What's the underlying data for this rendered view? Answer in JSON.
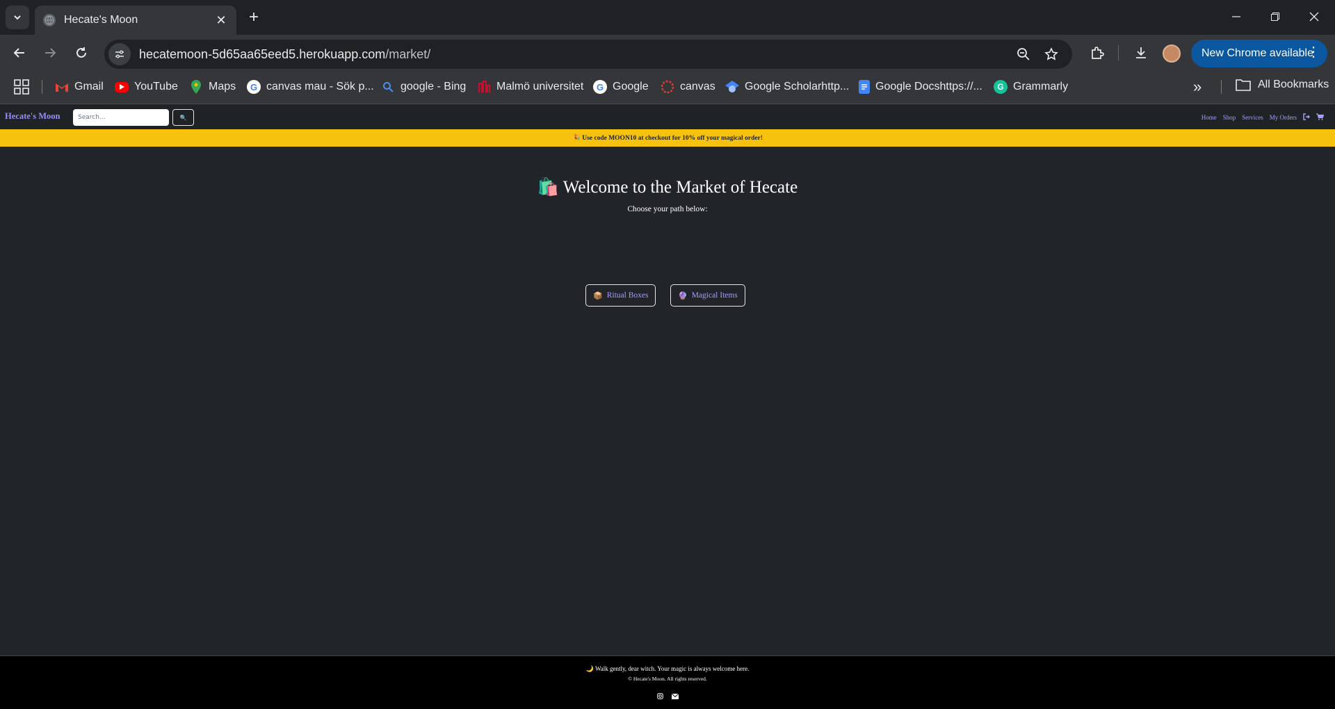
{
  "browser": {
    "tab_title": "Hecate's Moon",
    "url_host": "hecatemoon-5d65aa65eed5.herokuapp.com",
    "url_path": "/market/",
    "update_label": "New Chrome available",
    "bookmarks": [
      {
        "label": "Gmail",
        "icon": "gmail-icon"
      },
      {
        "label": "YouTube",
        "icon": "youtube-icon"
      },
      {
        "label": "Maps",
        "icon": "maps-icon"
      },
      {
        "label": "canvas mau - Sök p...",
        "icon": "google-icon"
      },
      {
        "label": "google - Bing",
        "icon": "bing-search-icon"
      },
      {
        "label": "Malmö universitet",
        "icon": "malmo-icon"
      },
      {
        "label": "Google",
        "icon": "google-icon"
      },
      {
        "label": "canvas",
        "icon": "canvas-icon"
      },
      {
        "label": "Google Scholarhttp...",
        "icon": "scholar-icon"
      },
      {
        "label": "Google Docshttps://...",
        "icon": "docs-icon"
      },
      {
        "label": "Grammarly",
        "icon": "grammarly-icon"
      }
    ],
    "all_bookmarks_label": "All Bookmarks"
  },
  "site": {
    "brand": "Hecate's Moon",
    "search_placeholder": "Search...",
    "search_button_icon": "🔍",
    "nav": {
      "home": "Home",
      "shop": "Shop",
      "services": "Services",
      "my_orders": "My Orders",
      "logout_icon": "⏻",
      "cart_icon": "🛒"
    },
    "promo": "🎉 Use code MOON10 at checkout for 10% off your magical order!",
    "hero": {
      "title": "🛍️ Welcome to the Market of Hecate",
      "subtitle": "Choose your path below:"
    },
    "paths": [
      {
        "icon": "📦",
        "label": "Ritual Boxes"
      },
      {
        "icon": "🔮",
        "label": "Magical Items"
      }
    ],
    "footer": {
      "tagline": "🌙 Walk gently, dear witch. Your magic is always welcome here.",
      "copyright": "© Hecate's Moon. All rights reserved."
    }
  },
  "colors": {
    "page_bg": "#212529",
    "promo_bg": "#f6c20d",
    "link": "#a99cff",
    "brand": "#9a8cf5",
    "footer_bg": "#000000"
  }
}
